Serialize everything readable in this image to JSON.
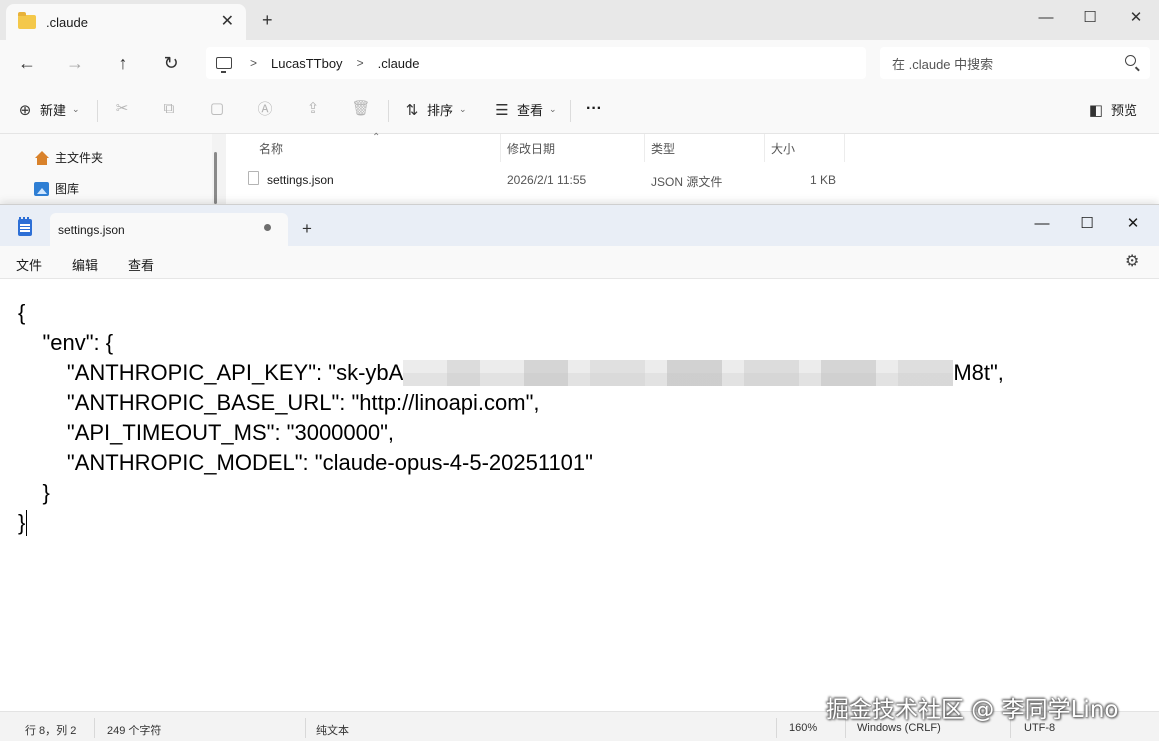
{
  "explorer": {
    "tab_title": ".claude",
    "new_tab_glyph": "+",
    "close_glyph": "✕",
    "window_controls": {
      "minimize": "—",
      "maximize": "☐",
      "close": "✕"
    },
    "nav": {
      "back": "←",
      "forward": "→",
      "up": "↑",
      "refresh": "↻"
    },
    "breadcrumb": [
      "LucasTTboy",
      ".claude"
    ],
    "breadcrumb_sep": ">",
    "search_placeholder": "在 .claude 中搜索",
    "toolbar": {
      "new_label": "新建",
      "sort_label": "排序",
      "view_label": "查看",
      "more_glyph": "···",
      "preview_label": "预览"
    },
    "sidebar": {
      "items": [
        {
          "label": "主文件夹",
          "icon": "home-icon"
        },
        {
          "label": "图库",
          "icon": "gallery-icon"
        }
      ]
    },
    "columns": {
      "name": "名称",
      "modified": "修改日期",
      "type": "类型",
      "size": "大小"
    },
    "files": [
      {
        "name": "settings.json",
        "modified": "2026/2/1 11:55",
        "type": "JSON 源文件",
        "size": "1 KB"
      }
    ]
  },
  "notepad": {
    "tab_title": "settings.json",
    "new_tab_glyph": "+",
    "window_controls": {
      "minimize": "—",
      "maximize": "☐",
      "close": "✕"
    },
    "menu": {
      "file": "文件",
      "edit": "编辑",
      "view": "查看"
    },
    "content": {
      "l1": "{",
      "l2": "    \"env\": {",
      "l3_pre": "        \"ANTHROPIC_API_KEY\": \"sk-ybA",
      "l3_post": "M8t\",",
      "l4": "        \"ANTHROPIC_BASE_URL\": \"http://linoapi.com\",",
      "l5": "        \"API_TIMEOUT_MS\": \"3000000\",",
      "l6": "        \"ANTHROPIC_MODEL\": \"claude-opus-4-5-20251101\"",
      "l7": "    }",
      "l8": "}"
    },
    "status": {
      "position": "行 8，列 2",
      "chars": "249 个字符",
      "format": "纯文本",
      "zoom": "160%",
      "line_ending": "Windows (CRLF)",
      "encoding": "UTF-8"
    }
  },
  "watermark": "掘金技术社区 @ 李同学Lino"
}
